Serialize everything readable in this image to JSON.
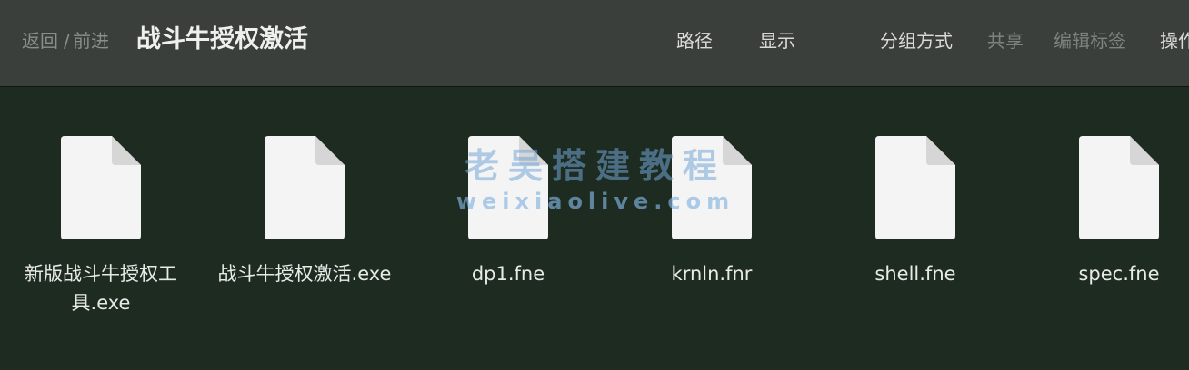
{
  "toolbar": {
    "back_label": "返回",
    "separator": "/",
    "forward_label": "前进",
    "title": "战斗牛授权激活",
    "path_label": "路径",
    "view_label": "显示",
    "group_label": "分组方式",
    "share_label": "共享",
    "tags_label": "编辑标签",
    "action_label": "操作"
  },
  "files": [
    {
      "name": "新版战斗牛授权工具.exe",
      "icon": "document-icon"
    },
    {
      "name": "战斗牛授权激活.exe",
      "icon": "document-icon"
    },
    {
      "name": "dp1.fne",
      "icon": "document-icon"
    },
    {
      "name": "krnln.fnr",
      "icon": "document-icon"
    },
    {
      "name": "shell.fne",
      "icon": "document-icon"
    },
    {
      "name": "spec.fne",
      "icon": "document-icon"
    }
  ],
  "watermark": {
    "line1": "老吴搭建教程",
    "line2": "weixiaolive.com"
  },
  "colors": {
    "toolbar_bg": "#3a3f3b",
    "content_bg": "#1d2b20",
    "text_primary": "#eef0ee",
    "text_disabled": "#7f837f"
  }
}
